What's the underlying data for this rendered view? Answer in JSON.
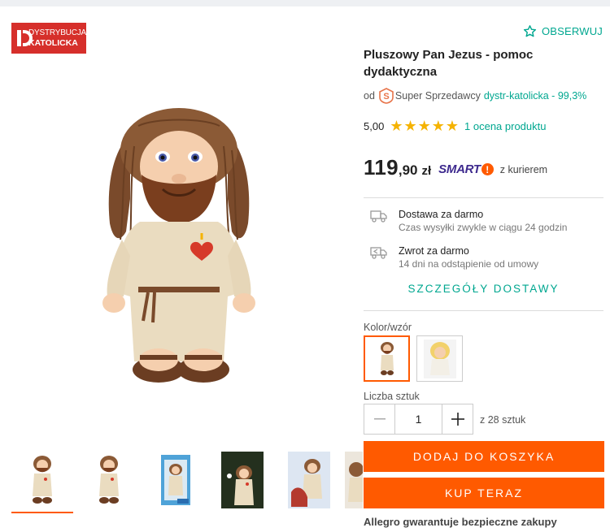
{
  "seller_logo": {
    "line1": "DYSTRYBUCJA",
    "line2": "KATOLICKA"
  },
  "product": {
    "watch_label": "OBSERWUJ",
    "title": "Pluszowy Pan Jezus - pomoc dydaktyczna",
    "seller_prefix": "od",
    "seller_badge": "Super Sprzedawcy",
    "seller_name": "dystr-katolicka - 99,3%",
    "rating_value": "5,00",
    "rating_stars": 5,
    "rating_link": "1 ocena produktu",
    "price_int": "119",
    "price_dec": ",90",
    "price_currency": "zł",
    "smart_label": "SMART",
    "smart_suffix": "z kurierem"
  },
  "delivery": {
    "shipping_title": "Dostawa za darmo",
    "shipping_sub": "Czas wysyłki zwykle w ciągu 24 godzin",
    "return_title": "Zwrot za darmo",
    "return_sub": "14 dni na odstąpienie od umowy",
    "details_link": "SZCZEGÓŁY DOSTAWY"
  },
  "variant": {
    "label": "Kolor/wzór",
    "selected_index": 0
  },
  "quantity": {
    "label": "Liczba sztuk",
    "value": "1",
    "available": "z 28 sztuk"
  },
  "actions": {
    "add_to_cart": "DODAJ DO KOSZYKA",
    "buy_now": "KUP TERAZ"
  },
  "guarantee": "Allegro gwarantuje bezpieczne zakupy",
  "colors": {
    "accent": "#ff5a00",
    "teal": "#00a790",
    "star": "#f5b301",
    "smart": "#3e2a8e",
    "logo_red": "#d62f2b"
  }
}
